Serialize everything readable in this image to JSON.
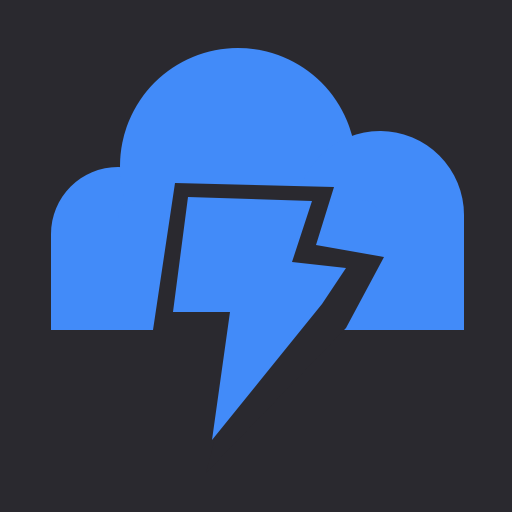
{
  "app_icon": {
    "name": "cloud-lightning-icon",
    "colors": {
      "background": "#2a292f",
      "cloud": "#428bf9",
      "bolt_outline": "#2a292f",
      "bolt_fill": "#428bf9"
    }
  }
}
